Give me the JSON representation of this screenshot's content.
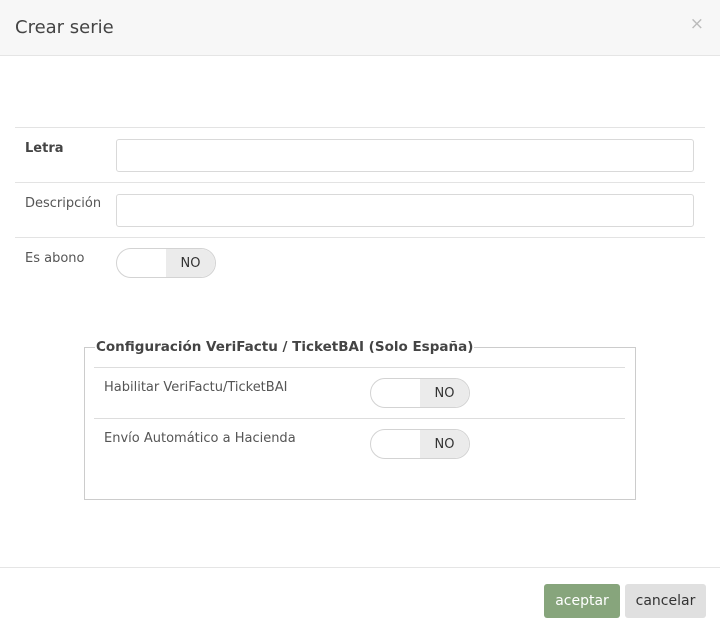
{
  "modal": {
    "title": "Crear serie",
    "close_icon": "×"
  },
  "form": {
    "letra_label": "Letra",
    "letra_value": "",
    "descripcion_label": "Descripción",
    "descripcion_value": "",
    "es_abono_label": "Es abono",
    "es_abono_state": "NO"
  },
  "verifactu": {
    "legend": "Configuración VeriFactu / TicketBAI (Solo España)",
    "habilitar_label": "Habilitar VeriFactu/TicketBAI",
    "habilitar_state": "NO",
    "envio_label": "Envío Automático a Hacienda",
    "envio_state": "NO"
  },
  "footer": {
    "accept_label": "aceptar",
    "cancel_label": "cancelar"
  },
  "colors": {
    "accept_button": "#87a57c",
    "cancel_button": "#e0e0e0",
    "header_bg": "#f7f7f7"
  }
}
